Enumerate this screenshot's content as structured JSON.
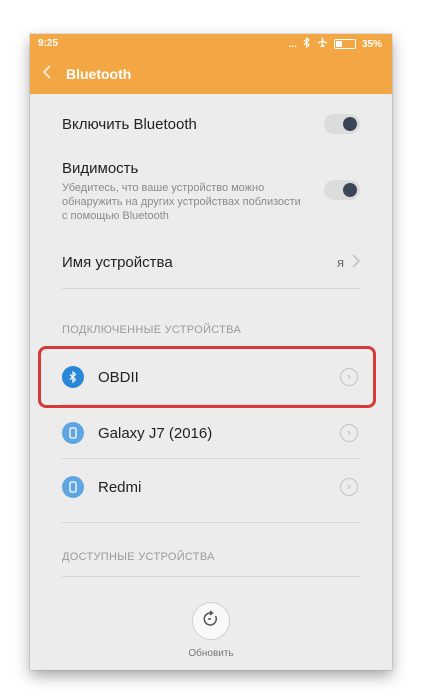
{
  "status_bar": {
    "time": "9:25",
    "icons": [
      "more-dots-icon",
      "bluetooth-icon",
      "airplane-icon",
      "battery-icon"
    ],
    "dots": "...",
    "battery": "35%"
  },
  "app_bar": {
    "back_icon": "chevron-left-icon",
    "title": "Bluetooth"
  },
  "settings": {
    "enable_bluetooth": {
      "label": "Включить Bluetooth",
      "enabled": true
    },
    "visibility": {
      "label": "Видимость",
      "description": "Убедитесь, что ваше устройство можно обнаружить на других устройствах поблизости с помощью Bluetooth",
      "enabled": true
    },
    "device_name": {
      "label": "Имя устройства",
      "value": "я"
    }
  },
  "connected_section": {
    "header": "ПОДКЛЮЧЕННЫЕ УСТРОЙСТВА",
    "devices": [
      {
        "name": "OBDII",
        "icon": "bluetooth-icon",
        "highlighted": true
      },
      {
        "name": "Galaxy J7 (2016)",
        "icon": "phone-icon",
        "highlighted": false
      },
      {
        "name": "Redmi",
        "icon": "phone-icon",
        "highlighted": false
      }
    ]
  },
  "available_section": {
    "header": "ДОСТУПНЫЕ УСТРОЙСТВА"
  },
  "refresh": {
    "label": "Обновить",
    "icon": "refresh-icon"
  },
  "colors": {
    "accent": "#f2a744",
    "toggle_knob": "#3a4657",
    "bluetooth_blue": "#2a86d6",
    "phone_blue": "#5fa5e0",
    "highlight_red": "#d63a3a"
  }
}
